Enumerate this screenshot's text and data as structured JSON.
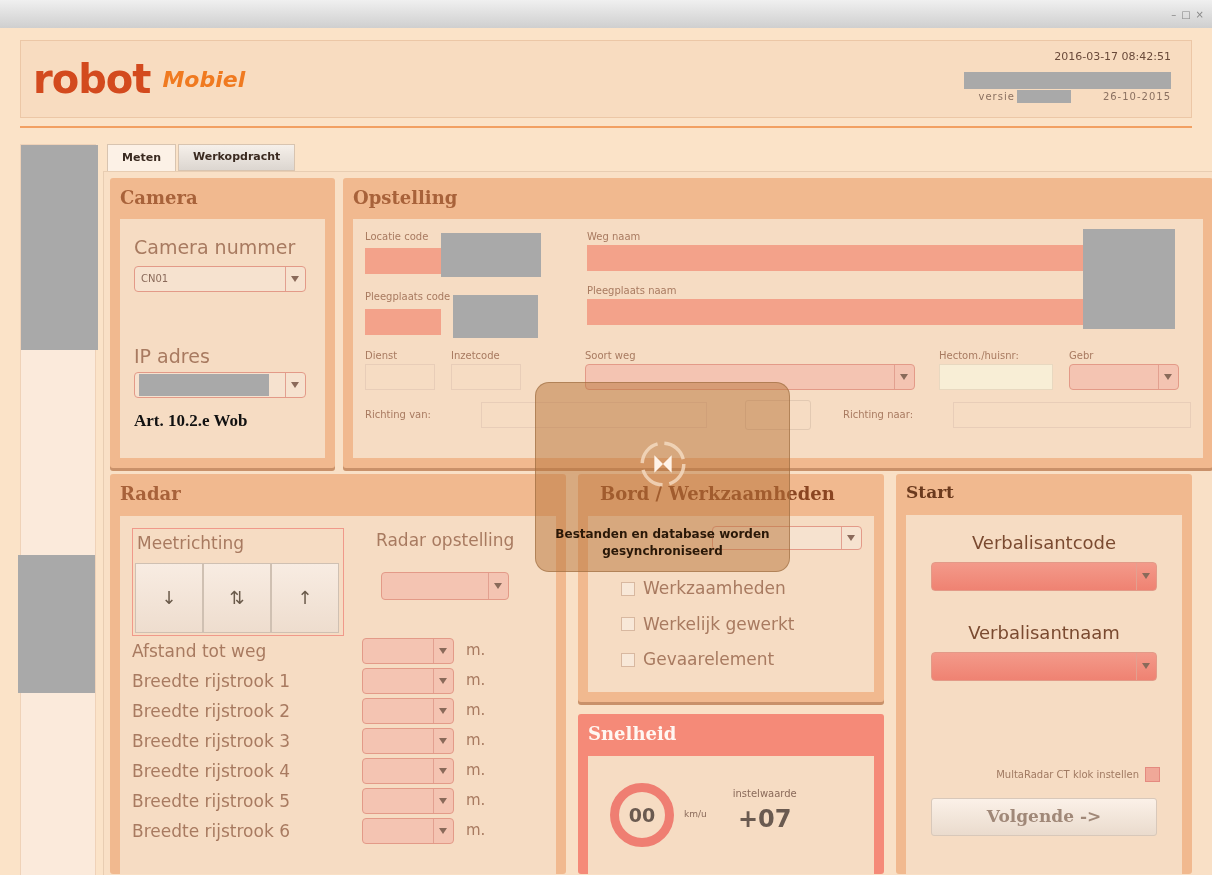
{
  "window": {
    "controls": [
      "–",
      "□",
      "×"
    ]
  },
  "header": {
    "logo": "robot",
    "app_name": "Mobiel",
    "datetime": "2016-03-17 08:42:51",
    "version_label": "versie",
    "version_date": "26-10-2015"
  },
  "tabs": [
    {
      "label": "Meten",
      "selected": true
    },
    {
      "label": "Werkopdracht",
      "selected": false
    }
  ],
  "camera": {
    "title": "Camera",
    "number_label": "Camera nummer",
    "number_value": "CN01",
    "ip_label": "IP adres",
    "note": "Art. 10.2.e Wob"
  },
  "opstelling": {
    "title": "Opstelling",
    "location_code_label": "Locatie code",
    "road_name_label": "Weg naam",
    "place_code_label": "Pleegplaats code",
    "place_name_label": "Pleegplaats naam",
    "service_label": "Dienst",
    "deploy_code_label": "Inzetcode",
    "road_type_label": "Soort weg",
    "hectometer_label": "Hectom./huisnr:",
    "used_label": "Gebr",
    "from_label": "Richting van:",
    "to_label": "Richting naar:"
  },
  "radar": {
    "title": "Radar",
    "direction_label": "Meetrichting",
    "direction_buttons": [
      "↓",
      "⇅",
      "↑"
    ],
    "setup_label": "Radar opstelling",
    "rows": [
      {
        "label": "Afstand tot weg",
        "unit": "m."
      },
      {
        "label": "Breedte rijstrook 1",
        "unit": "m."
      },
      {
        "label": "Breedte rijstrook 2",
        "unit": "m."
      },
      {
        "label": "Breedte rijstrook 3",
        "unit": "m."
      },
      {
        "label": "Breedte rijstrook 4",
        "unit": "m."
      },
      {
        "label": "Breedte rijstrook 5",
        "unit": "m."
      },
      {
        "label": "Breedte rijstrook 6",
        "unit": "m."
      }
    ]
  },
  "bord": {
    "title": "Bord / Werkzaamheden",
    "checkboxes": [
      {
        "label": "Werkzaamheden",
        "checked": false
      },
      {
        "label": "Werkelijk gewerkt",
        "checked": false
      },
      {
        "label": "Gevaarelement",
        "checked": false
      }
    ]
  },
  "snelheid": {
    "title": "Snelheid",
    "speed": "00",
    "unit": "km/u",
    "setting_label": "instelwaarde",
    "setting_value": "+07"
  },
  "start": {
    "title": "Start",
    "code_label": "Verbalisantcode",
    "name_label": "Verbalisantnaam",
    "clock_label": "MultaRadar CT klok instellen",
    "clock_checked": false,
    "next_button": "Volgende ->"
  },
  "overlay": {
    "message": "Bestanden en database worden gesynchroniseerd"
  }
}
